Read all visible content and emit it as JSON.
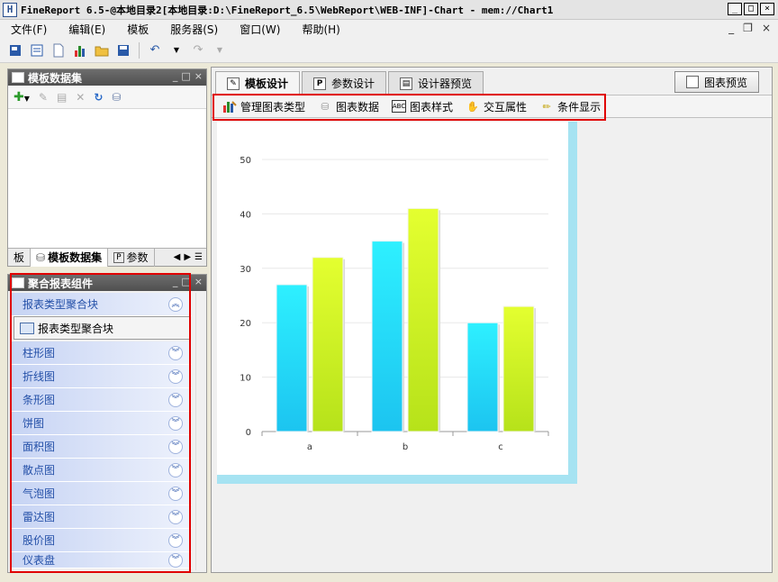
{
  "window": {
    "title": "FineReport 6.5-@本地目录2[本地目录:D:\\FineReport_6.5\\WebReport\\WEB-INF]-Chart - mem://Chart1",
    "app_icon": "H",
    "controls": [
      "_",
      "□",
      "×"
    ]
  },
  "menubar": {
    "items": [
      "文件(F)",
      "编辑(E)",
      "模板",
      "服务器(S)",
      "窗口(W)",
      "帮助(H)"
    ],
    "mdi_controls": [
      "_",
      "❐",
      "×"
    ]
  },
  "dataset_panel": {
    "title": "模板数据集",
    "tabs": [
      "板",
      "模板数据集",
      "参数"
    ]
  },
  "component_panel": {
    "title": "聚合报表组件",
    "items": [
      {
        "label": "报表类型聚合块",
        "expanded": true,
        "sub": "报表类型聚合块"
      },
      {
        "label": "柱形图"
      },
      {
        "label": "折线图"
      },
      {
        "label": "条形图"
      },
      {
        "label": "饼图"
      },
      {
        "label": "面积图"
      },
      {
        "label": "散点图"
      },
      {
        "label": "气泡图"
      },
      {
        "label": "雷达图"
      },
      {
        "label": "股价图"
      },
      {
        "label": "仪表盘"
      }
    ]
  },
  "main": {
    "tabs": [
      "模板设计",
      "参数设计",
      "设计器预览"
    ],
    "preview_button": "图表预览",
    "chart_toolbar": [
      "管理图表类型",
      "图表数据",
      "图表样式",
      "交互属性",
      "条件显示"
    ]
  },
  "chart_data": {
    "type": "bar",
    "categories": [
      "a",
      "b",
      "c"
    ],
    "series": [
      {
        "values": [
          27,
          35,
          20
        ],
        "color": "#1cc4f0"
      },
      {
        "values": [
          32,
          41,
          23
        ],
        "color": "#b6e21a"
      }
    ],
    "ylim": [
      0,
      50
    ],
    "yticks": [
      0,
      10,
      20,
      30,
      40,
      50
    ],
    "grid": true
  },
  "colors": {
    "highlight": "#e00000",
    "chart_frame": "#a6e3f2",
    "comp_text": "#2450a8"
  }
}
